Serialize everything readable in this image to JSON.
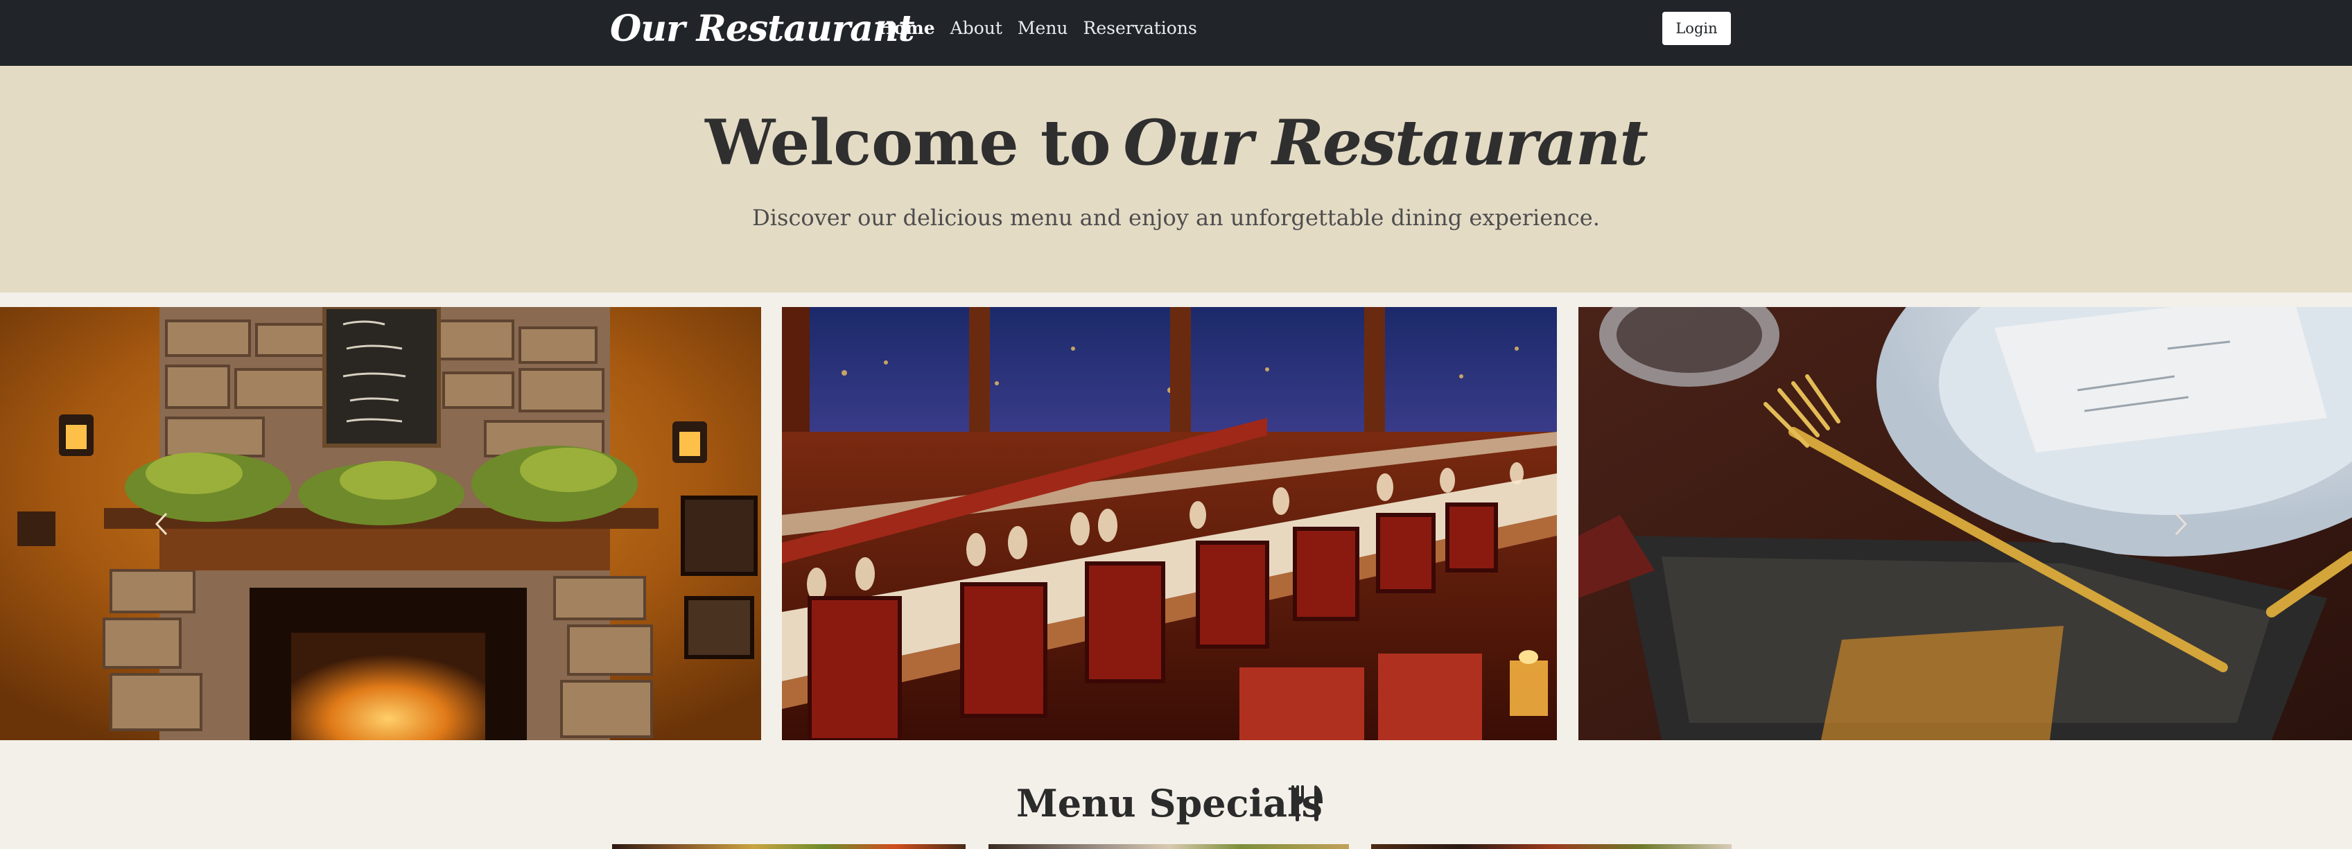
{
  "navbar": {
    "brand": "Our Restaurant",
    "links": [
      "Home",
      "About",
      "Menu",
      "Reservations"
    ],
    "active_link": "Home",
    "login_label": "Login"
  },
  "hero": {
    "title_prefix": "Welcome to",
    "title_name": "Our Restaurant",
    "subtitle": "Discover our delicious menu and enjoy an unforgettable dining experience."
  },
  "carousel": {
    "slides": [
      "fireplace-interior-photo",
      "dining-hall-photo",
      "table-setting-photo"
    ],
    "prev_icon": "chevron-left-icon",
    "next_icon": "chevron-right-icon"
  },
  "specials": {
    "title": "Menu Specials",
    "icon": "utensils-icon"
  },
  "colors": {
    "navbar_bg": "#212529",
    "hero_bg": "#e4dbc5",
    "page_bg": "#f3f0e9",
    "text_dark": "#2f2f2f"
  }
}
